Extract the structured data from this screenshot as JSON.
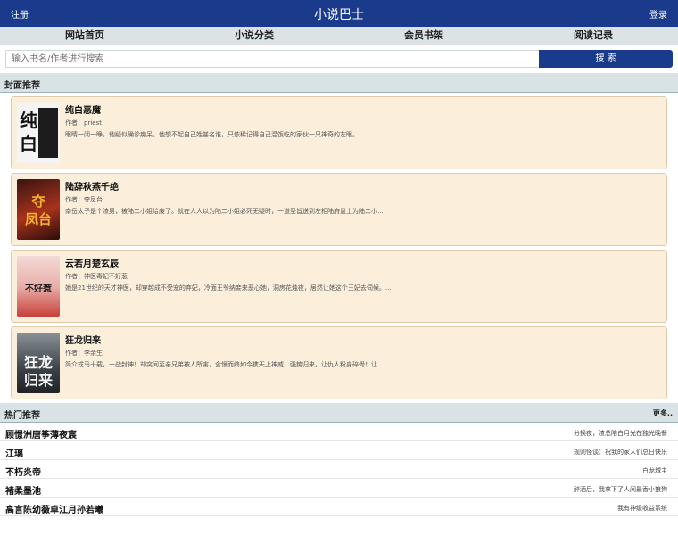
{
  "header": {
    "register": "注册",
    "title": "小说巴士",
    "login": "登录"
  },
  "nav": [
    {
      "label": "网站首页"
    },
    {
      "label": "小说分类"
    },
    {
      "label": "会员书架"
    },
    {
      "label": "阅读记录"
    }
  ],
  "search": {
    "placeholder": "输入书名/作者进行搜索",
    "button": "搜 索"
  },
  "featured": {
    "heading": "封面推荐",
    "books": [
      {
        "title": "纯白恶魔",
        "author": "作者：priest",
        "desc": "眼睛一闭一睁，他疑似确诊痴呆。他想不起自己姓甚名谁，只依稀记得自己混饭吃的家伙一只神奇的左眼。..."
      },
      {
        "title": "陆辞秋燕千绝",
        "author": "作者：夺凤台",
        "desc": "南岳太子是个渣男，被陆二小姐给废了。就在人人以为陆二小姐必死无疑时，一道圣旨送到左相陆府皇上为陆二小..."
      },
      {
        "title": "云若月楚玄辰",
        "author": "作者：神医毒妃不好惹",
        "desc": "她是21世纪的天才神医，却穿越成不受宠的弃妃，冷面王爷纳妾来恶心她，洞房花烛夜，居然让她这个王妃去伺候。..."
      },
      {
        "title": "狂龙归来",
        "author": "作者：李余生",
        "desc": "简介戎马十载，一战封神！却突闻至亲兄弟被人所害，含恨而终如今携天上神威，强势归来，让仇人粉身碎骨！让..."
      }
    ]
  },
  "hot": {
    "heading": "热门推荐",
    "more": "更多..",
    "items": [
      {
        "name": "顾憬洲唐筝薄夜宸",
        "latest": "分换夜，渣总陪白月光在独光晚餐"
      },
      {
        "name": "江璃",
        "latest": "规则怪谈：祝我的家人们总日快乐"
      },
      {
        "name": "不朽炎帝",
        "latest": "白龙城主"
      },
      {
        "name": "褚柔墨池",
        "latest": "醉酒后，我拿下了人间最香小狼狗"
      },
      {
        "name": "高言陈幼薇卓江月孙若曦",
        "latest": "我有神级收益系统"
      }
    ]
  }
}
